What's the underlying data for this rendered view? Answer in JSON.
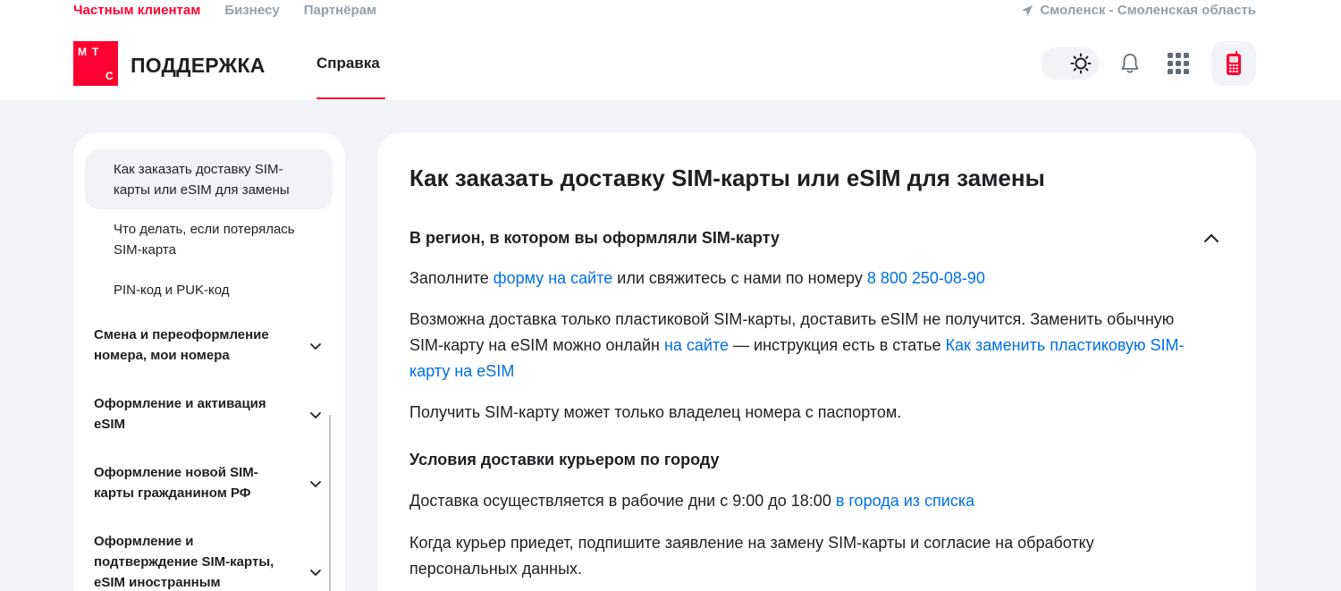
{
  "header": {
    "topnav": [
      "Частным клиентам",
      "Бизнесу",
      "Партнёрам"
    ],
    "region": "Смоленск - Смоленская область",
    "logo_letters": [
      "М",
      "Т",
      "С"
    ],
    "brand": "ПОДДЕРЖКА",
    "nav_tab": "Справка",
    "accent": "#ff0032"
  },
  "sidebar": {
    "sub_items": [
      "Как заказать доставку SIM-карты или eSIM для замены",
      "Что делать, если потерялась SIM-карта",
      "PIN-код и PUK-код"
    ],
    "sections": [
      "Смена и переоформление номера, мои номера",
      "Оформление и активация eSIM",
      "Оформление новой SIM-карты гражданином РФ",
      "Оформление и подтверждение SIM-карты, eSIM иностранным"
    ]
  },
  "article": {
    "title": "Как заказать доставку SIM-карты или eSIM для замены",
    "accordion_title": "В регион, в котором вы оформляли SIM-карту",
    "p1": {
      "t1": "Заполните ",
      "link1": "форму на сайте",
      "t2": " или свяжитесь с нами по номеру ",
      "link2": "8 800 250-08-90"
    },
    "p2": {
      "t1": "Возможна доставка только пластиковой SIM-карты, доставить eSIM не получится. Заменить обычную SIM-карту на eSIM можно онлайн ",
      "link1": "на сайте",
      "t2": " — инструкция есть в статье ",
      "link2": "Как заменить пластиковую SIM-карту на eSIM"
    },
    "p3": "Получить SIM-карту может только владелец номера с паспортом.",
    "subtitle": "Условия доставки курьером по городу",
    "p4": {
      "t1": "Доставка осуществляется в рабочие дни с 9:00 до 18:00 ",
      "link1": "в города из списка"
    },
    "p5": "Когда курьер приедет, подпишите заявление на замену SIM-карты и согласие на обработку персональных данных.",
    "link_color": "#0070e5"
  }
}
